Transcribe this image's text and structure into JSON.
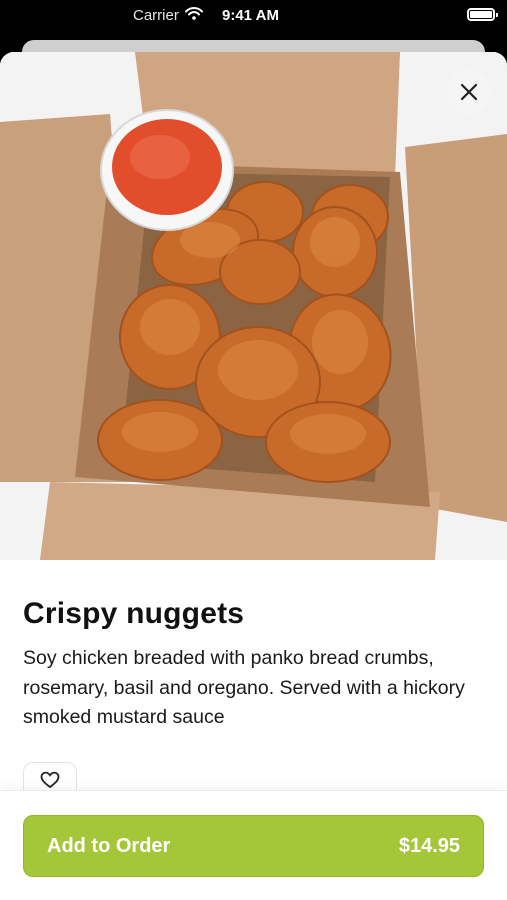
{
  "status_bar": {
    "carrier": "Carrier",
    "time": "9:41 AM"
  },
  "product": {
    "name": "Crispy nuggets",
    "description": "Soy chicken breaded with panko bread crumbs, rosemary, basil and oregano. Served with a hickory smoked mustard sauce",
    "price": "$14.95"
  },
  "actions": {
    "add_to_order_label": "Add to Order"
  },
  "icons": {
    "close": "close-icon",
    "favorite": "heart-icon",
    "wifi": "wifi-icon",
    "battery": "battery-icon"
  },
  "colors": {
    "accent": "#a4c639",
    "button_text": "#ffffff"
  }
}
